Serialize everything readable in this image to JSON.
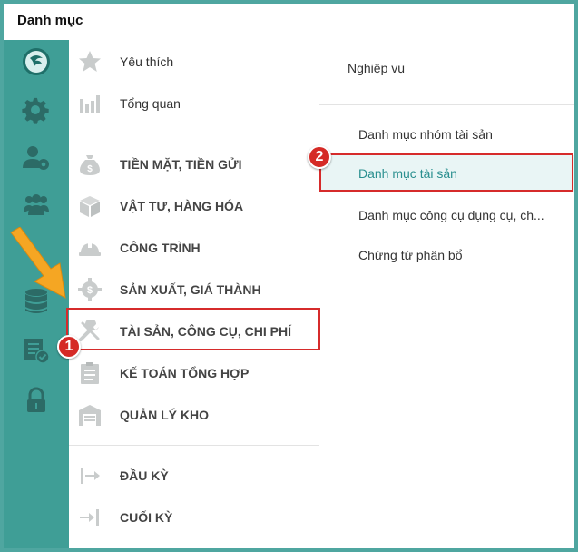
{
  "window": {
    "title": "Danh mục"
  },
  "rail": {
    "icons": [
      "app-logo-icon",
      "gear-icon",
      "user-settings-icon",
      "group-icon",
      "database-icon",
      "document-check-icon",
      "lock-icon"
    ]
  },
  "menu": {
    "items": [
      {
        "label": "Yêu thích",
        "icon": "star-icon"
      },
      {
        "label": "Tổng quan",
        "icon": "bar-chart-icon"
      },
      {
        "label": "TIỀN MẶT, TIỀN GỬI",
        "icon": "money-bag-icon"
      },
      {
        "label": "VẬT TƯ, HÀNG HÓA",
        "icon": "box-icon"
      },
      {
        "label": "CÔNG TRÌNH",
        "icon": "helmet-icon"
      },
      {
        "label": "SẢN XUẤT, GIÁ THÀNH",
        "icon": "gear-dollar-icon"
      },
      {
        "label": "TÀI SẢN, CÔNG CỤ, CHI PHÍ",
        "icon": "tools-icon"
      },
      {
        "label": "KẾ TOÁN TỔNG HỢP",
        "icon": "clipboard-icon"
      },
      {
        "label": "QUẢN LÝ KHO",
        "icon": "warehouse-icon"
      },
      {
        "label": "ĐẦU KỲ",
        "icon": "arrow-right-bar-icon"
      },
      {
        "label": "CUỐI KỲ",
        "icon": "arrow-into-bar-icon"
      }
    ]
  },
  "submenu": {
    "header": "Nghiệp vụ",
    "items": [
      {
        "label": "Danh mục nhóm tài sản"
      },
      {
        "label": "Danh mục tài sản"
      },
      {
        "label": "Danh mục công cụ dụng cụ, ch..."
      },
      {
        "label": "Chứng từ phân bổ"
      }
    ]
  },
  "annotations": {
    "step1": "1",
    "step2": "2",
    "highlight_color": "#d62b2b",
    "arrow_color": "#f5a623"
  },
  "colors": {
    "rail": "#3f9e96",
    "frame": "#4fa6a0",
    "selected_text": "#2a8f8f",
    "selected_bg": "#e9f5f5",
    "icon_gray": "#c9cccc"
  }
}
